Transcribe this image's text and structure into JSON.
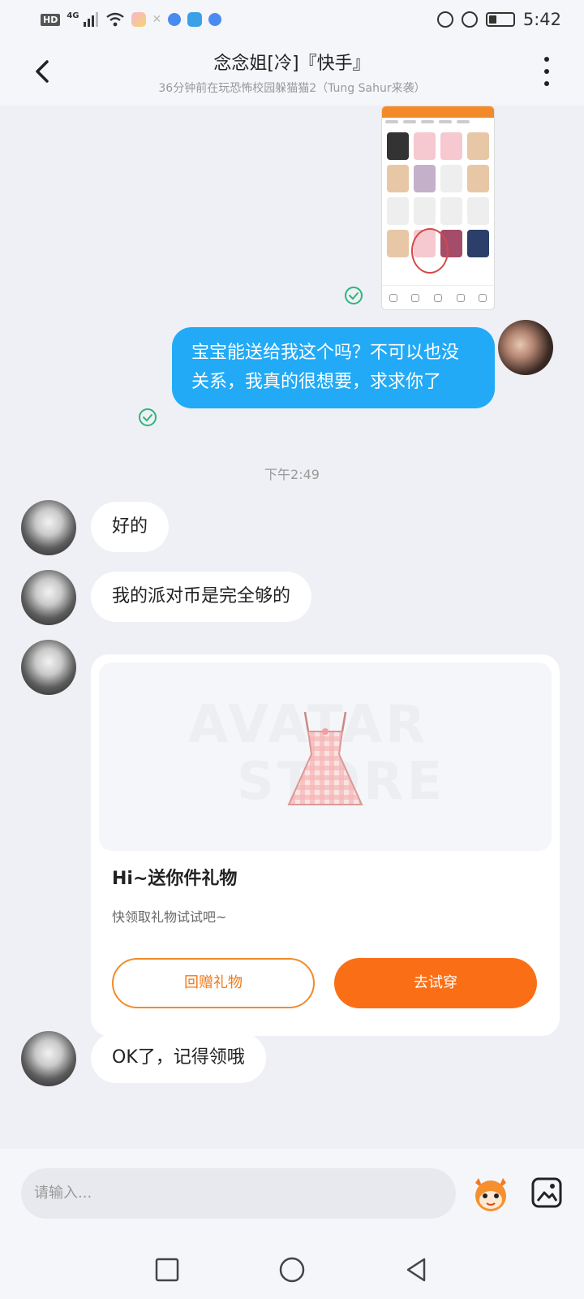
{
  "status_bar": {
    "hd": "HD",
    "network": "4G",
    "time": "5:42"
  },
  "header": {
    "title": "念念姐[冷]『快手』",
    "subtitle": "36分钟前在玩恐怖校园躲猫猫2（Tung Sahur来袭）"
  },
  "messages": {
    "outgoing_text": "宝宝能送给我这个吗？不可以也没关系，我真的很想要，求求你了",
    "timestamp": "下午2:49",
    "reply_1": "好的",
    "reply_2": "我的派对币是完全够的",
    "reply_3": "OK了，记得领哦"
  },
  "gift_card": {
    "title": "Hi~送你件礼物",
    "subtitle": "快领取礼物试试吧~",
    "return_button": "回赠礼物",
    "try_button": "去试穿"
  },
  "input": {
    "placeholder": "请输入..."
  },
  "icons": {
    "back": "chevron-left-icon",
    "more": "more-vertical-icon",
    "emoji": "emoji-mascot-icon",
    "image": "image-icon",
    "read": "check-circle-icon"
  },
  "colors": {
    "outgoing_bubble": "#22aaf6",
    "accent_orange": "#fa6f16",
    "read_check": "#2fb47a"
  }
}
